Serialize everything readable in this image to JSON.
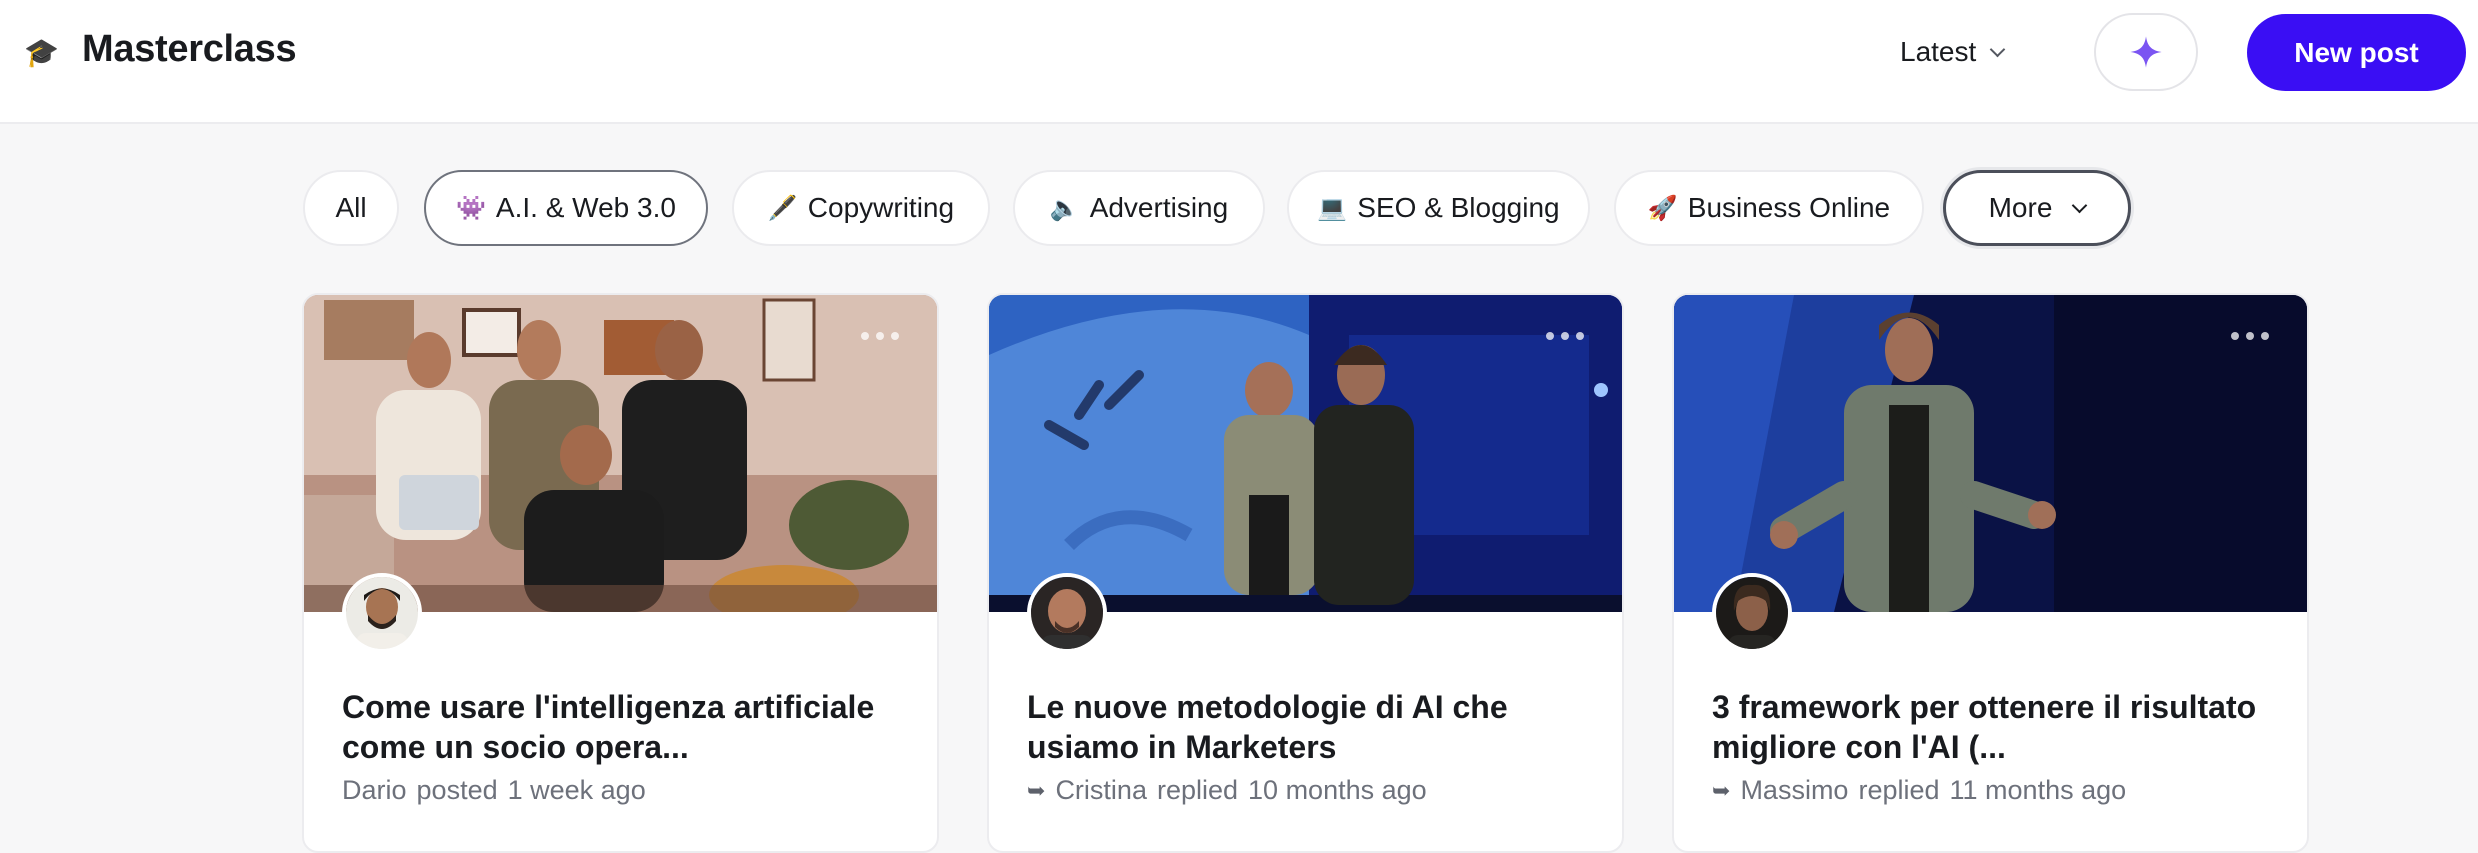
{
  "header": {
    "logo_icon": "graduation-cap-icon",
    "logo_glyph": "🎓",
    "title": "Masterclass",
    "sort_label": "Latest",
    "ai_button_icon": "sparkle-icon",
    "new_post_label": "New post",
    "accent_color": "#3a0ef4"
  },
  "filters": [
    {
      "emoji": "",
      "label": "All",
      "selected": false
    },
    {
      "emoji": "👾",
      "label": "A.I. & Web 3.0",
      "selected": true
    },
    {
      "emoji": "🖋️",
      "label": "Copywriting",
      "selected": false
    },
    {
      "emoji": "🔈",
      "label": "Advertising",
      "selected": false
    },
    {
      "emoji": "💻",
      "label": "SEO & Blogging",
      "selected": false
    },
    {
      "emoji": "🚀",
      "label": "Business Online",
      "selected": false
    },
    {
      "emoji": "",
      "label": "More",
      "selected": false
    }
  ],
  "posts": [
    {
      "title": "Come usare l'intelligenza artificiale come un socio opera...",
      "author": "Dario",
      "action": "posted",
      "time": "1 week ago",
      "is_reply": false
    },
    {
      "title": "Le nuove metodologie di AI che usiamo in Marketers",
      "author": "Cristina",
      "action": "replied",
      "time": "10 months ago",
      "is_reply": true
    },
    {
      "title": "3 framework per ottenere il risultato migliore con l'AI (...",
      "author": "Massimo",
      "action": "replied",
      "time": "11 months ago",
      "is_reply": true
    }
  ]
}
